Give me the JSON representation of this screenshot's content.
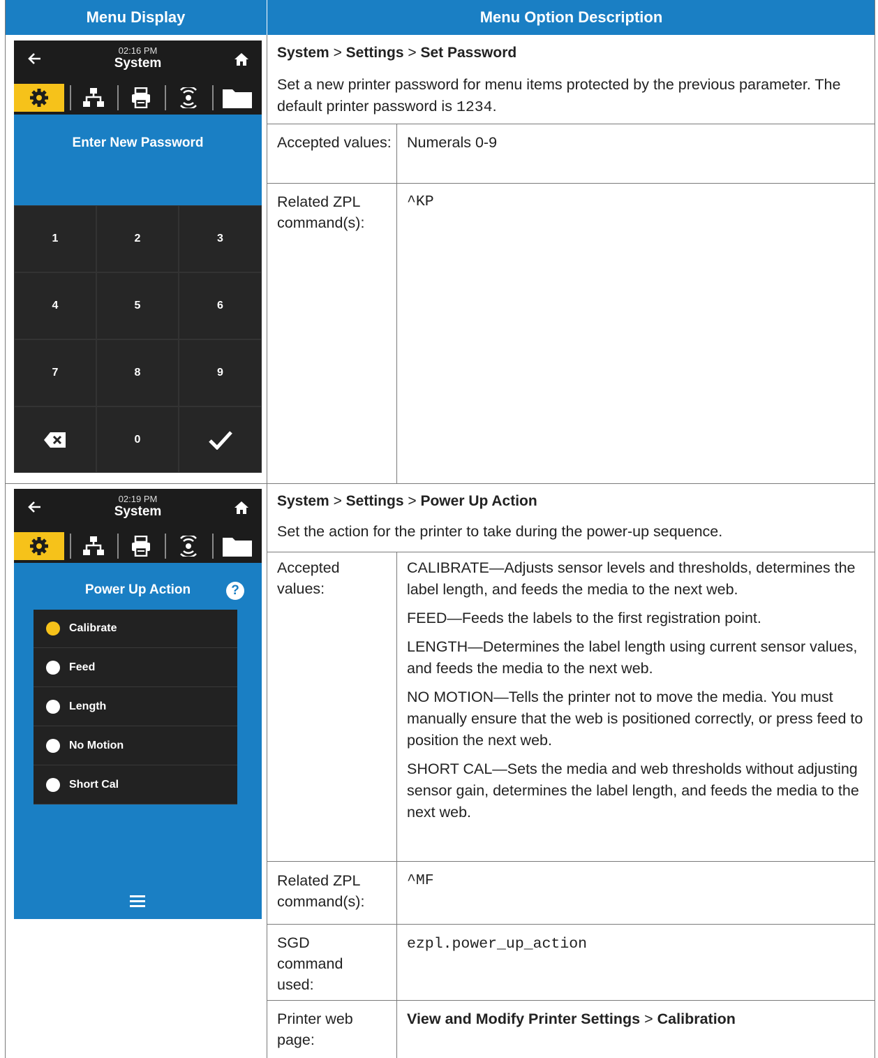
{
  "header": {
    "col1": "Menu Display",
    "col2": "Menu Option Description"
  },
  "rows": [
    {
      "breadcrumb": [
        "System",
        "Settings",
        "Set Password"
      ],
      "description_text": "Set a new printer password for menu items protected by the previous parameter. The default printer password is",
      "description_code": "1234",
      "description_end": ".",
      "fields": [
        {
          "label": "Accepted values:",
          "value": "Numerals 0-9"
        },
        {
          "label": "Related ZPL command(s):",
          "value": "^KP"
        }
      ],
      "screen": {
        "time": "02:16 PM",
        "title": "System",
        "heading": "Enter New Password",
        "keys": [
          "1",
          "2",
          "3",
          "4",
          "5",
          "6",
          "7",
          "8",
          "9",
          "",
          "0",
          ""
        ]
      }
    },
    {
      "breadcrumb": [
        "System",
        "Settings",
        "Power Up Action"
      ],
      "description_text": "Set the action for the printer to take during the power-up sequence.",
      "fields": [
        {
          "label": "Accepted values:",
          "values": [
            "CALIBRATE—Adjusts sensor levels and thresholds, determines the label length, and feeds the media to the next web.",
            "FEED—Feeds the labels to the first registration point.",
            "LENGTH—Determines the label length using current sensor values, and feeds the media to the next web.",
            "NO MOTION—Tells the printer not to move the media. You must manually ensure that the web is positioned correctly, or press feed to position the next web.",
            "SHORT CAL—Sets the media and web thresholds without adjusting sensor gain, determines the label length, and feeds the media to the next web."
          ]
        },
        {
          "label": "Related ZPL command(s):",
          "value": "^MF"
        },
        {
          "label": "SGD command used:",
          "value": "ezpl.power_up_action"
        },
        {
          "label": "Printer web page:",
          "value_bold_1": "View and Modify Printer Settings",
          "value_sep": ">",
          "value_bold_2": "Calibration"
        }
      ],
      "screen": {
        "time": "02:19 PM",
        "title": "System",
        "heading": "Power Up Action",
        "help": "?",
        "options": [
          "Calibrate",
          "Feed",
          "Length",
          "No Motion",
          "Short Cal"
        ],
        "selected": "Calibrate"
      }
    }
  ],
  "breadcrumb_sep": ">",
  "colors": {
    "header_blue": "#1a7fc4",
    "device_blue": "#1a7fc4",
    "device_dark": "#1c1c1c",
    "selected_yellow": "#f6c21a"
  }
}
